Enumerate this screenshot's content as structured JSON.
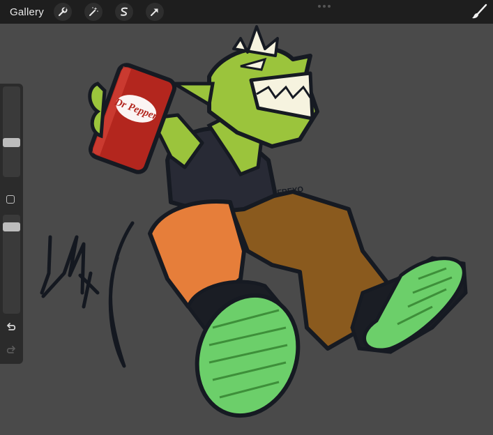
{
  "toolbar": {
    "gallery_label": "Gallery",
    "tools": [
      {
        "name": "actions",
        "icon": "wrench-icon"
      },
      {
        "name": "adjustments",
        "icon": "magic-wand-icon"
      },
      {
        "name": "selection",
        "icon": "selection-s-icon"
      },
      {
        "name": "transform",
        "icon": "arrow-cursor-icon"
      }
    ],
    "brush_icon": "paintbrush-icon"
  },
  "sidebar": {
    "brush_size_icon": "slider-thumb",
    "opacity_icon": "slider-thumb",
    "modify_icon": "square-icon",
    "undo_icon": "undo-icon",
    "redo_icon": "redo-icon"
  },
  "artwork": {
    "can_label": "Dr Pepper",
    "signature_text": "FREYO"
  },
  "colors": {
    "topbar": "#1e1e1e",
    "canvas_bg": "#4a4a4a",
    "skin": "#9bc43c",
    "pants_orange": "#e67e3a",
    "pants_brown": "#8a5a1e",
    "shoe_green": "#6ccf6a",
    "can_red": "#b3261e"
  }
}
